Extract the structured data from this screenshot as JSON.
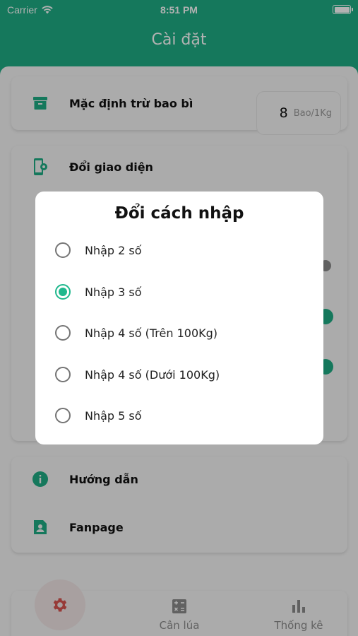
{
  "status_bar": {
    "carrier": "Carrier",
    "time": "8:51 PM"
  },
  "header": {
    "title": "Cài đặt"
  },
  "settings": {
    "packaging": {
      "label": "Mặc định trừ bao bì",
      "value": "8",
      "unit": "Bao/1Kg",
      "icon": "archive-icon"
    },
    "theme": {
      "label": "Đổi giao diện",
      "icon": "phone-settings-icon"
    },
    "guide": {
      "label": "Hướng dẫn",
      "icon": "info-icon"
    },
    "fanpage": {
      "label": "Fanpage",
      "icon": "contact-page-icon"
    }
  },
  "dialog": {
    "title": "Đổi cách nhập",
    "selected_index": 1,
    "options": [
      {
        "label": "Nhập 2 số"
      },
      {
        "label": "Nhập 3 số"
      },
      {
        "label": "Nhập 4 số (Trên 100Kg)"
      },
      {
        "label": "Nhập 4 số (Dưới 100Kg)"
      },
      {
        "label": "Nhập 5 số"
      }
    ]
  },
  "tab_bar": {
    "settings_icon": "gear-icon",
    "weigh": {
      "label": "Cân lúa",
      "icon": "calculator-icon"
    },
    "stats": {
      "label": "Thống kê",
      "icon": "bar-chart-icon"
    }
  },
  "colors": {
    "accent": "#1fad84",
    "active_tab_icon": "#d9534f"
  }
}
